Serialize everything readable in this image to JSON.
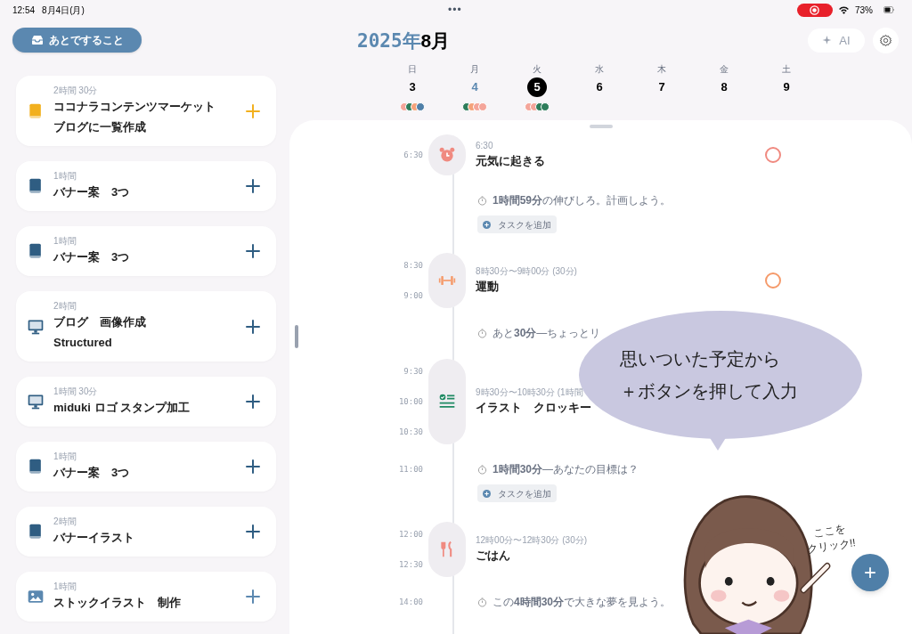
{
  "status_bar": {
    "time": "12:54",
    "date": "8月4日(月)",
    "dots": "•••",
    "battery_text": "73%"
  },
  "later_button": {
    "label": "あとですること"
  },
  "header": {
    "year": "2025年",
    "month": "8月",
    "ai_button": {
      "label": "AI",
      "disabled": true
    }
  },
  "week": [
    {
      "weekday": "日",
      "day": "3",
      "today": false,
      "selected": false,
      "dots": [
        {
          "color": "#f4a59a"
        },
        {
          "color": "#2e7d5b"
        },
        {
          "color": "#f4a27a"
        },
        {
          "color": "#4f7fa8"
        }
      ]
    },
    {
      "weekday": "月",
      "day": "4",
      "today": true,
      "selected": false,
      "dots": [
        {
          "color": "#2e7d5b"
        },
        {
          "color": "#f4a27a"
        },
        {
          "color": "#f4a59a"
        },
        {
          "color": "#f4a59a"
        }
      ]
    },
    {
      "weekday": "火",
      "day": "5",
      "today": false,
      "selected": true,
      "dots": [
        {
          "color": "#f4a59a"
        },
        {
          "color": "#f4a59a"
        },
        {
          "color": "#2e7d5b"
        },
        {
          "color": "#2e7d5b"
        }
      ]
    },
    {
      "weekday": "水",
      "day": "6",
      "today": false,
      "selected": false
    },
    {
      "weekday": "木",
      "day": "7",
      "today": false,
      "selected": false
    },
    {
      "weekday": "金",
      "day": "8",
      "today": false,
      "selected": false
    },
    {
      "weekday": "土",
      "day": "9",
      "today": false,
      "selected": false
    }
  ],
  "later_tasks": [
    {
      "duration": "2時間 30分",
      "title_lines": [
        "ココナラコンテンツマーケット",
        "ブログに一覧作成"
      ],
      "kind": "book",
      "color": "#f2b01e"
    },
    {
      "duration": "1時間",
      "title_lines": [
        "バナー案　3つ"
      ],
      "kind": "book",
      "color": "#2f5d82"
    },
    {
      "duration": "1時間",
      "title_lines": [
        "バナー案　3つ"
      ],
      "kind": "book",
      "color": "#2f5d82"
    },
    {
      "duration": "2時間",
      "title_lines": [
        "ブログ　画像作成",
        "Structured"
      ],
      "kind": "monitor",
      "color": "#2f5d82"
    },
    {
      "duration": "1時間 30分",
      "title_lines": [
        "miduki ロゴ スタンプ加工"
      ],
      "kind": "monitor",
      "color": "#2f5d82"
    },
    {
      "duration": "1時間",
      "title_lines": [
        "バナー案　3つ"
      ],
      "kind": "book",
      "color": "#2f5d82"
    },
    {
      "duration": "2時間",
      "title_lines": [
        "バナーイラスト"
      ],
      "kind": "book",
      "color": "#2f5d82"
    },
    {
      "duration": "1時間",
      "title_lines": [
        "ストックイラスト　制作"
      ],
      "kind": "image",
      "color": "#5b88b0"
    }
  ],
  "timeline": [
    {
      "kind": "wake",
      "times": [
        "6:30"
      ],
      "range": "6:30",
      "title": "元気に起きる",
      "color": "#f08a80"
    },
    {
      "kind": "gap",
      "note": "**1時間59分**の伸びしろ。計画しよう。",
      "add_label": "タスクを追加"
    },
    {
      "kind": "exercise",
      "times": [
        "8:30",
        "9:00"
      ],
      "range": "8時30分〜9時00分 (30分)",
      "title": "運動",
      "color": "#f59a6a"
    },
    {
      "kind": "gap",
      "note": "あと**30分**—ちょっとリ"
    },
    {
      "kind": "task",
      "times": [
        "9:30",
        "10:00",
        "10:30"
      ],
      "range": "9時30分〜10時30分 (1時間",
      "title": "イラスト　クロッキー"
    },
    {
      "kind": "gap",
      "times": [
        "11:00"
      ],
      "note": "**1時間30分**—あなたの目標は？",
      "add_label": "タスクを追加"
    },
    {
      "kind": "meal",
      "times": [
        "12:00",
        "12:30"
      ],
      "range": "12時00分〜12時30分 (30分)",
      "title": "ごはん"
    },
    {
      "kind": "gap",
      "times": [
        "14:00"
      ],
      "note": "この**4時間30分**で大きな夢を見よう。"
    }
  ],
  "annotation": {
    "bubble_lines": [
      "思いついた予定から",
      "＋ボタンを押して入力"
    ],
    "hint_lines": [
      "ここを",
      "クリック!!"
    ]
  },
  "add_button": {
    "label": "+"
  }
}
